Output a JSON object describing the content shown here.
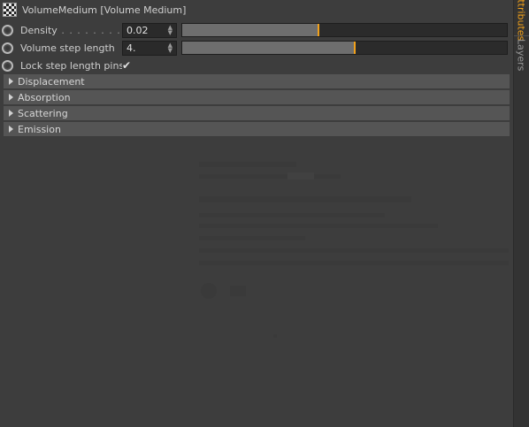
{
  "header": {
    "title": "VolumeMedium [Volume Medium]"
  },
  "params": [
    {
      "label": "Density",
      "dots": " . . . . . . . . . . . .",
      "value": "0.02",
      "slider_fraction": 0.42
    },
    {
      "label": "Volume step length",
      "value": "4.",
      "slider_fraction": 0.53
    }
  ],
  "lock_row": {
    "label": "Lock step length pins",
    "checked": true,
    "check_glyph": "✔"
  },
  "sections": [
    {
      "label": "Displacement"
    },
    {
      "label": "Absorption"
    },
    {
      "label": "Scattering"
    },
    {
      "label": "Emission"
    }
  ],
  "sidebar": {
    "tabs": [
      {
        "label": "Attributes",
        "active": true
      },
      {
        "label": "Layers",
        "active": false
      }
    ]
  },
  "colors": {
    "accent": "#f2a11a",
    "panel_bg": "#3d3d3d",
    "section_bg": "#555555"
  },
  "icons": {
    "object": "checkerboard-icon",
    "spinner": "spinner-arrows-icon",
    "section_toggle": "triangle-right-icon"
  }
}
